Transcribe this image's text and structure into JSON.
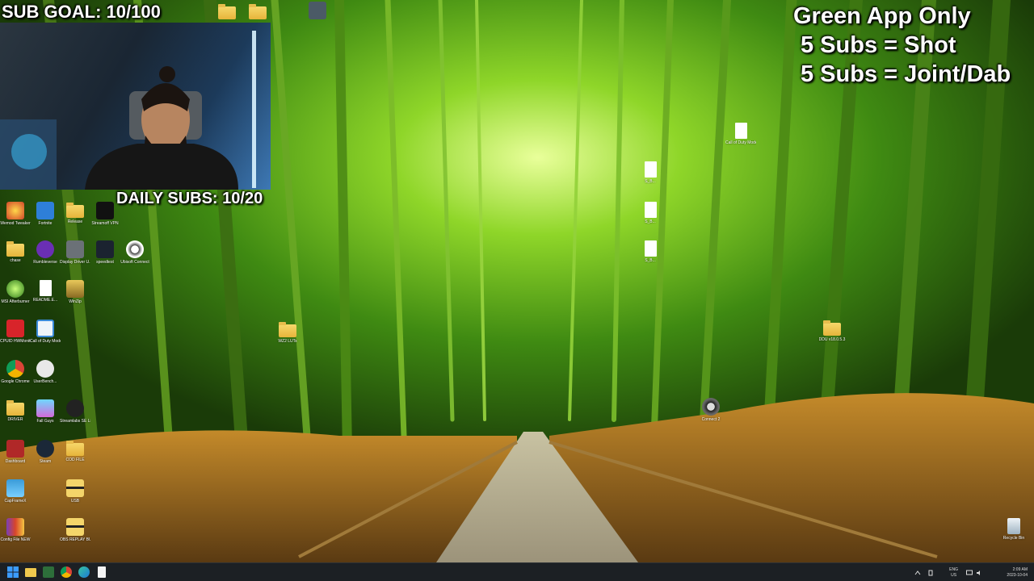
{
  "overlay": {
    "sub_goal": "SUB GOAL: 10/100",
    "daily_subs": "DAILY SUBS: 10/20",
    "rules": [
      "Green App Only",
      "5 Subs = Shot",
      "5 Subs = Joint/Dab"
    ]
  },
  "desktop_icons": {
    "wemod": "Wemod Tweaker",
    "fortnite": "Fortnite",
    "release": "Release",
    "streamoff": "Streamoff VPN",
    "chase": "chase",
    "rumbleverse": "Rumbleverse",
    "display_driver": "Display Driver U...",
    "speedtest": "speedtest",
    "ubisoft": "Ubisoft Connect",
    "msi": "MSI Afterburner",
    "readme": "README.E...",
    "winzip": "WinZip",
    "cpuid": "CPUID HWMonitor",
    "cod_mw": "Call of Duty Modern...",
    "chrome": "Google Chrome",
    "userbench": "UserBench...",
    "drivers": "DRIVER",
    "fall_guys": "Fall Guys",
    "streamlabs": "Streamlabs SE Live",
    "dashboard": "Dashboard",
    "steam": "Steam",
    "cod_file": "COD FILE",
    "capframex": "CapFrameX",
    "usb": "USB",
    "config": "Config File NEW",
    "obs_replay": "OBS REPLAY BUFFER",
    "wz2_luts": "WZ2 LUTs",
    "cod_config": "Call of Duty Modern...",
    "file_a": "S_B...",
    "file_b": "S_B...",
    "file_c": "S_B...",
    "ddu": "DDU v18.0.5.3",
    "connect": "Connect 2",
    "recycle_bin": "Recycle Bin"
  },
  "taskbar": {
    "lang_top": "ENG",
    "lang_bottom": "US",
    "time": "2:09 AM",
    "date": "2023-10-04"
  },
  "colors": {
    "folder": "#f0c94e",
    "taskbar": "#1c2024",
    "windows_blue": "#3b9cff"
  }
}
